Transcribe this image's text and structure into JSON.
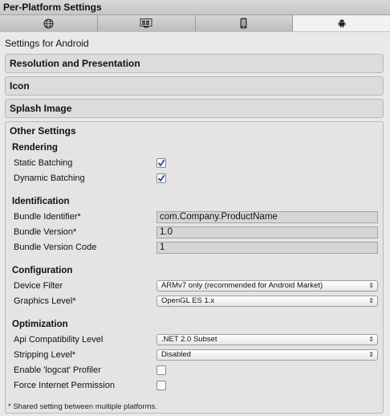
{
  "window": {
    "title": "Per-Platform Settings"
  },
  "tabs": [
    {
      "icon": "globe-icon"
    },
    {
      "icon": "windows-icon"
    },
    {
      "icon": "mobile-phone-icon"
    },
    {
      "icon": "android-icon",
      "active": true
    }
  ],
  "settings_for": "Settings for Android",
  "sections": {
    "resolution": "Resolution and Presentation",
    "icon": "Icon",
    "splash": "Splash Image",
    "other": "Other Settings"
  },
  "rendering": {
    "title": "Rendering",
    "static_batching": {
      "label": "Static Batching",
      "checked": true
    },
    "dynamic_batching": {
      "label": "Dynamic Batching",
      "checked": true
    }
  },
  "identification": {
    "title": "Identification",
    "bundle_identifier": {
      "label": "Bundle Identifier*",
      "value": "com.Company.ProductName"
    },
    "bundle_version": {
      "label": "Bundle Version*",
      "value": "1.0"
    },
    "bundle_version_code": {
      "label": "Bundle Version Code",
      "value": "1"
    }
  },
  "configuration": {
    "title": "Configuration",
    "device_filter": {
      "label": "Device Filter",
      "value": "ARMv7 only (recommended for Android Market)"
    },
    "graphics_level": {
      "label": "Graphics Level*",
      "value": "OpenGL ES 1.x"
    }
  },
  "optimization": {
    "title": "Optimization",
    "api_compat": {
      "label": "Api Compatibility Level",
      "value": ".NET 2.0 Subset"
    },
    "stripping": {
      "label": "Stripping Level*",
      "value": "Disabled"
    },
    "logcat": {
      "label": "Enable 'logcat' Profiler",
      "checked": false
    },
    "internet": {
      "label": "Force Internet Permission",
      "checked": false
    }
  },
  "footnote": "* Shared setting between multiple platforms.",
  "colors": {
    "check_blue": "#2a4f9e",
    "panel": "#e9e9e9",
    "active_tab": "#f2f2f2"
  }
}
